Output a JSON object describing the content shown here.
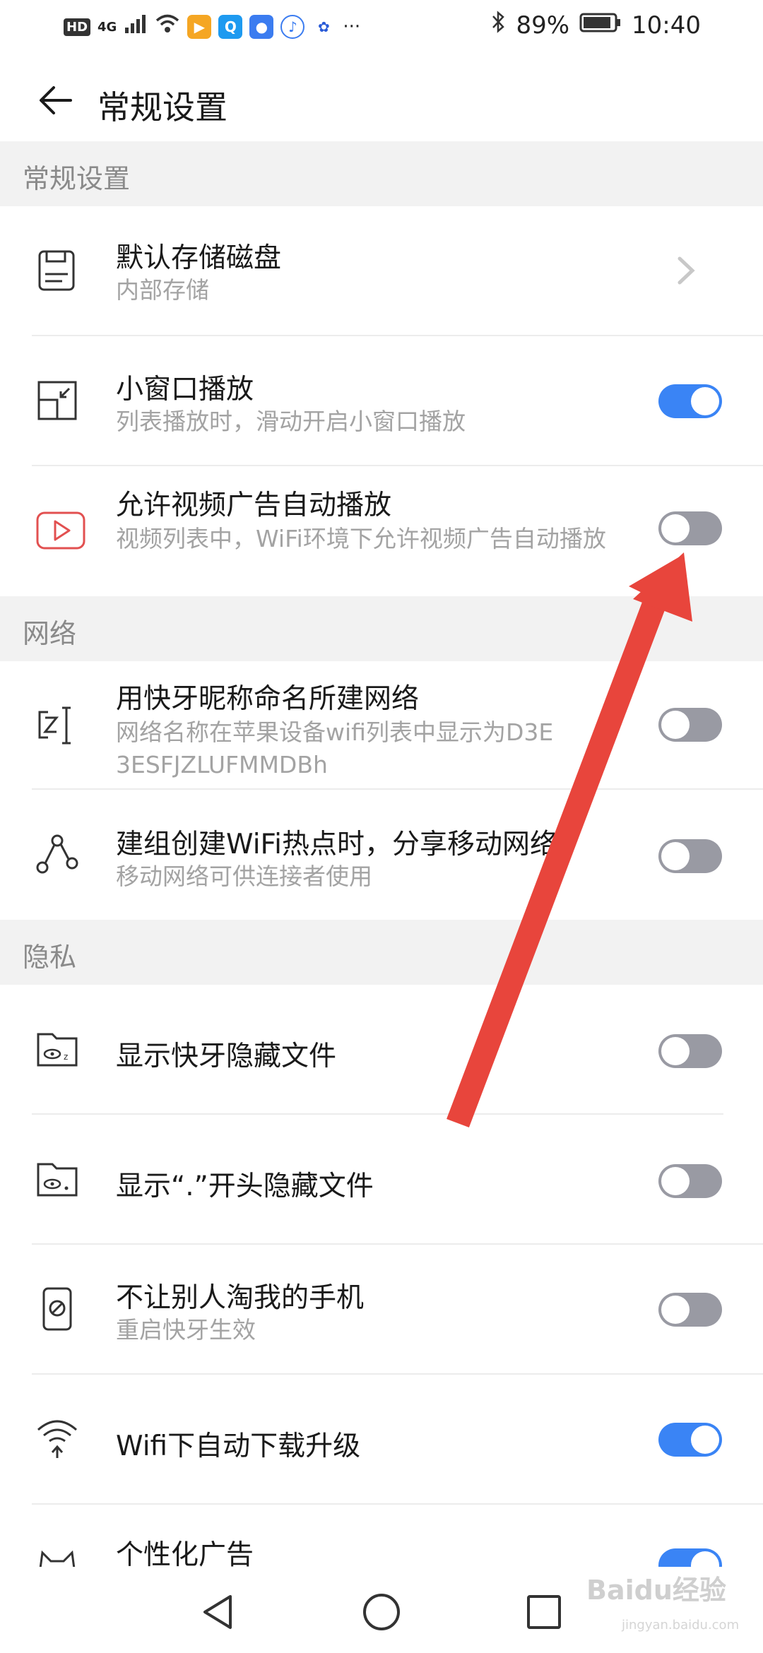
{
  "status": {
    "network": "HD",
    "signal_label": "4G",
    "battery": "89%",
    "time": "10:40",
    "more": "···"
  },
  "header": {
    "title": "常规设置"
  },
  "sections": {
    "general": "常规设置",
    "network": "网络",
    "privacy": "隐私"
  },
  "items": [
    {
      "title": "默认存储磁盘",
      "subtitle": "内部存储",
      "control": "chevron"
    },
    {
      "title": "小窗口播放",
      "subtitle": "列表播放时，滑动开启小窗口播放",
      "control": "toggle",
      "on": true
    },
    {
      "title": "允许视频广告自动播放",
      "subtitle": "视频列表中，WiFi环境下允许视频广告自动播放",
      "control": "toggle",
      "on": false
    },
    {
      "title": "用快牙昵称命名所建网络",
      "subtitle": "网络名称在苹果设备wifi列表中显示为D3E3ESFJZLUFMMDBh",
      "control": "toggle",
      "on": false
    },
    {
      "title": "建组创建WiFi热点时，分享移动网络",
      "subtitle": "移动网络可供连接者使用",
      "control": "toggle",
      "on": false
    },
    {
      "title": "显示快牙隐藏文件",
      "subtitle": "",
      "control": "toggle",
      "on": false
    },
    {
      "title": "显示“.”开头隐藏文件",
      "subtitle": "",
      "control": "toggle",
      "on": false
    },
    {
      "title": "不让别人淘我的手机",
      "subtitle": "重启快牙生效",
      "control": "toggle",
      "on": false
    },
    {
      "title": "Wifi下自动下载升级",
      "subtitle": "",
      "control": "toggle",
      "on": true
    },
    {
      "title": "个性化广告",
      "subtitle": "",
      "control": "toggle",
      "on": true
    }
  ],
  "watermark": {
    "brand": "Baidu经验",
    "site": "jingyan.baidu.com"
  },
  "colors": {
    "accent": "#3a84f5",
    "toggle_off": "#999aa3",
    "annotation_arrow": "#e8453c"
  }
}
